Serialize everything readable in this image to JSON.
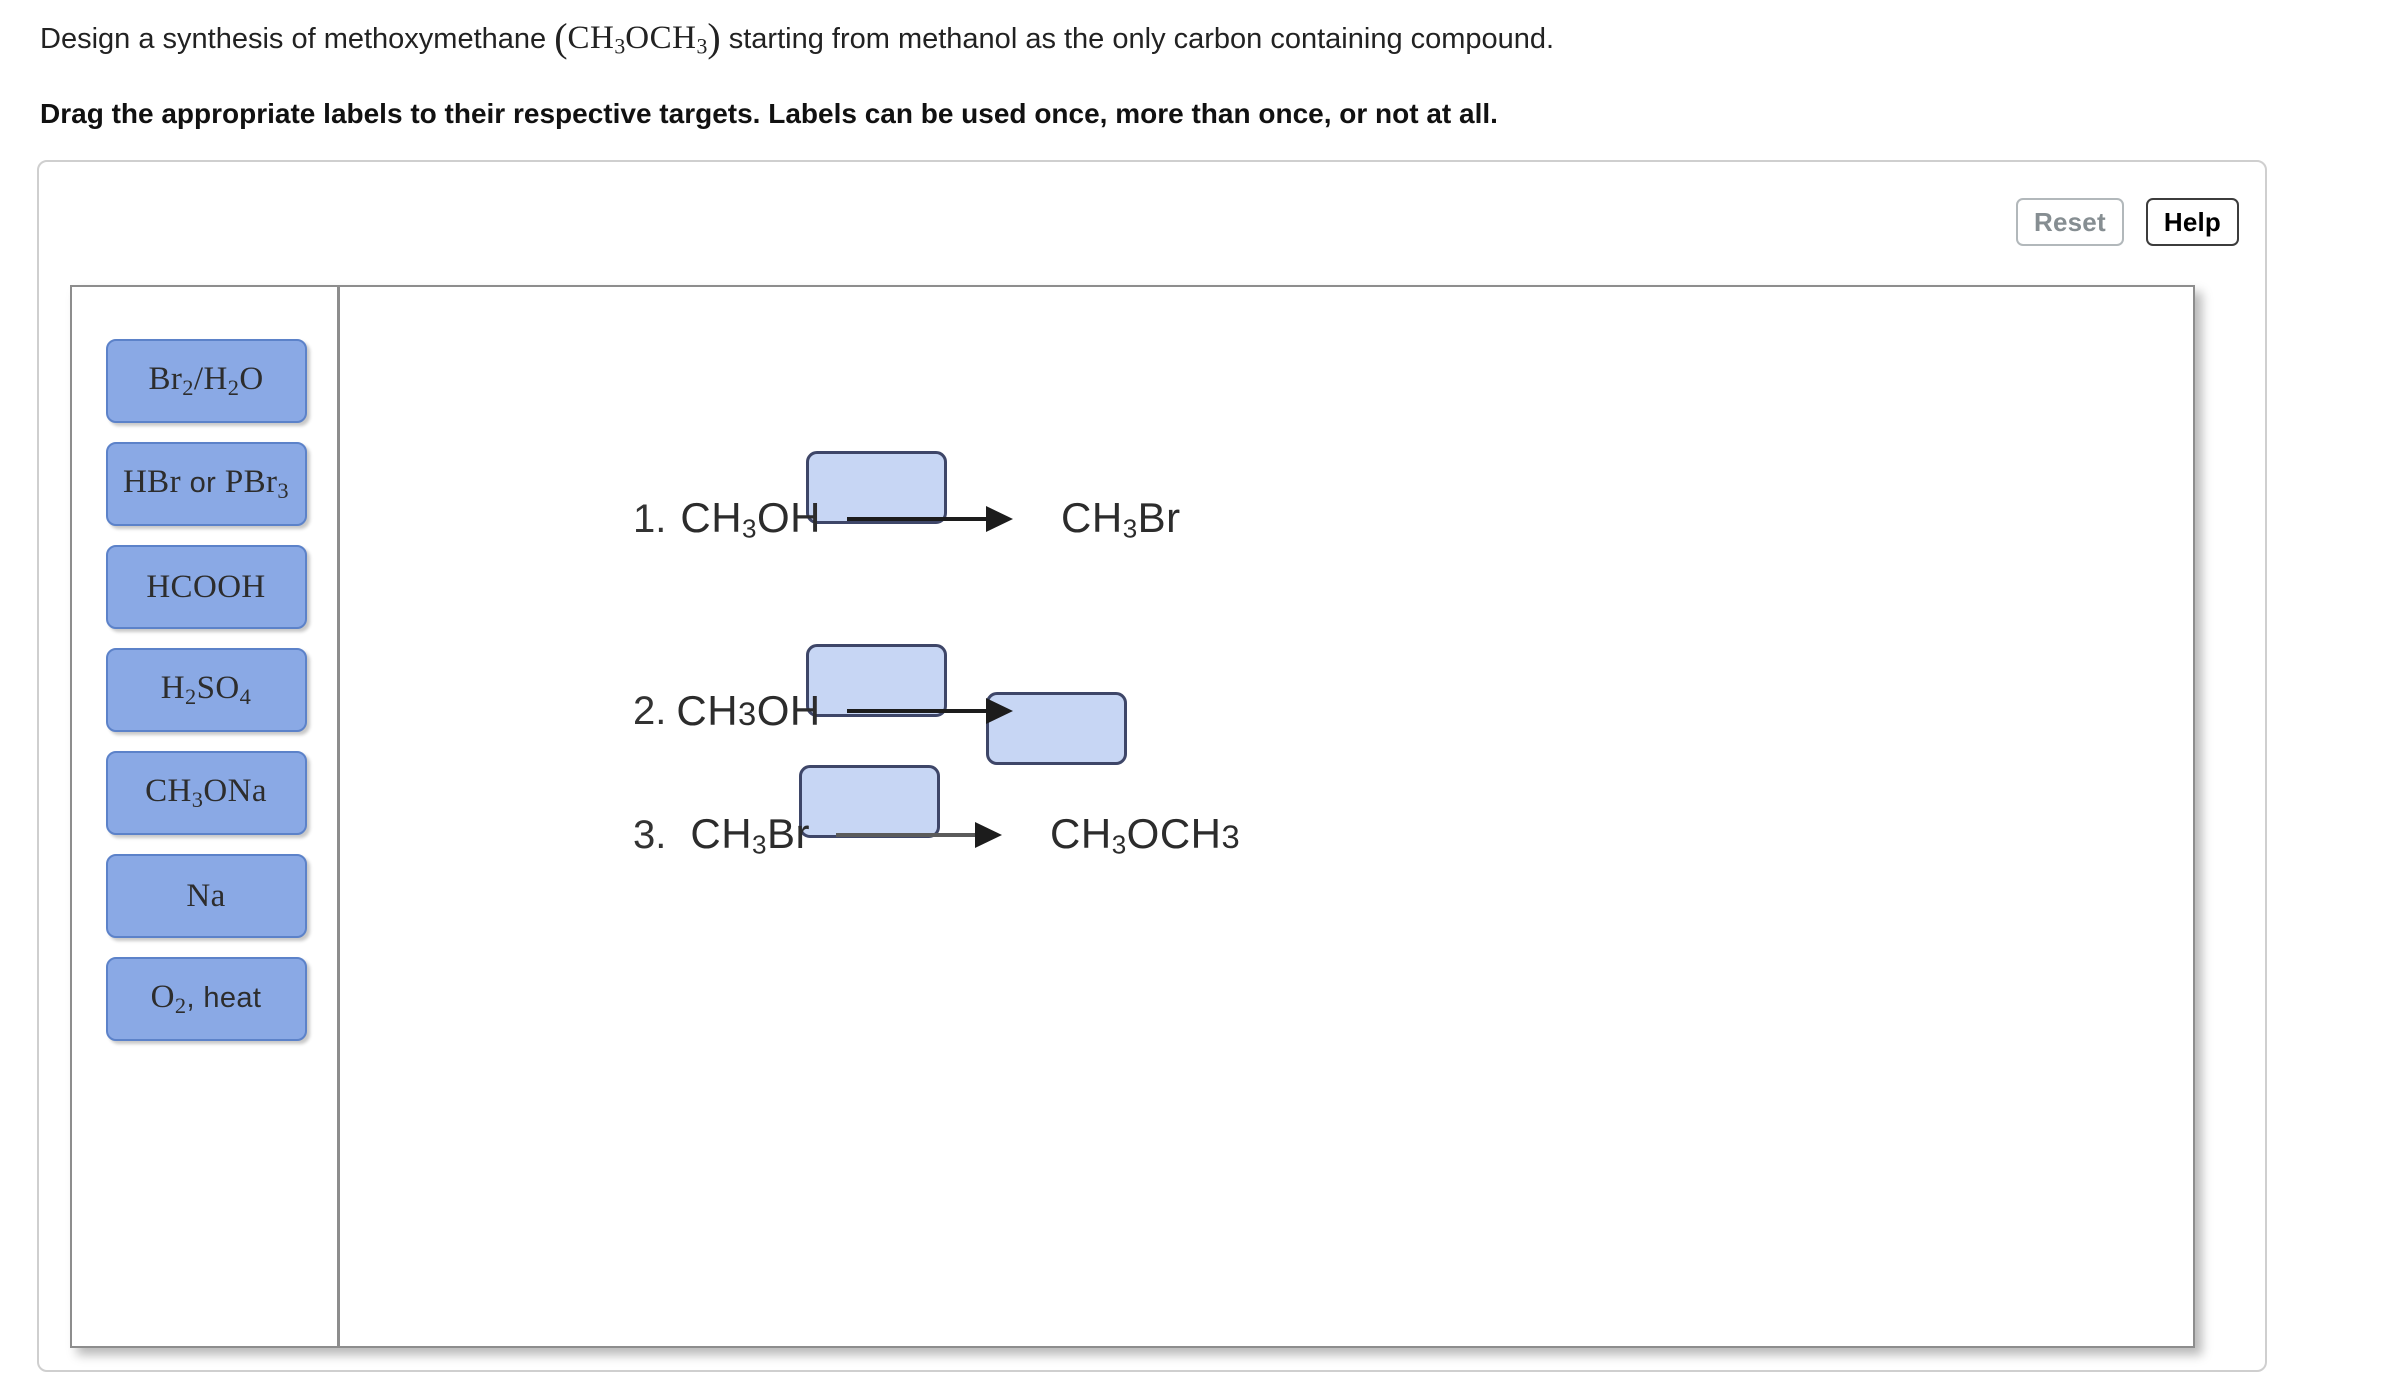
{
  "prompt": {
    "line1_before": "Design a synthesis of methoxymethane ",
    "line1_formula_open": "(",
    "line1_formula": "CH3OCH3",
    "line1_formula_close": ")",
    "line1_after": " starting from methanol as the only carbon containing compound.",
    "line2": "Drag the appropriate labels to their respective targets. Labels can be used once, more than once, or not at all."
  },
  "toolbar": {
    "reset_label": "Reset",
    "help_label": "Help"
  },
  "label_bank": {
    "tiles": [
      {
        "id": "br2-h2o",
        "text": "Br2/H2O"
      },
      {
        "id": "hbr-or-pbr3",
        "text": "HBr or PBr3"
      },
      {
        "id": "hcooh",
        "text": "HCOOH"
      },
      {
        "id": "h2so4",
        "text": "H2SO4"
      },
      {
        "id": "ch3ona",
        "text": "CH3ONa"
      },
      {
        "id": "na",
        "text": "Na"
      },
      {
        "id": "o2-heat",
        "text": "O2, heat"
      }
    ]
  },
  "scheme": {
    "rows": [
      {
        "number": "1.",
        "reactant": "CH3OH",
        "product": "CH3Br",
        "reagent_target": "",
        "product_is_target": false
      },
      {
        "number": "2.",
        "reactant": "CH3OH",
        "product": "",
        "reagent_target": "",
        "product_is_target": true
      },
      {
        "number": "3.",
        "reactant": "CH3Br",
        "product": "CH3OCH3",
        "reagent_target": "",
        "product_is_target": false
      }
    ]
  },
  "colors": {
    "tile_fill": "#8aa9e5",
    "tile_border": "#5c82c9",
    "target_fill": "#c7d6f4",
    "target_border": "#3e4668",
    "card_border": "#cfcfcf",
    "workspace_border": "#8d8d8d",
    "help_text": "#000000",
    "reset_text": "#868e92"
  }
}
